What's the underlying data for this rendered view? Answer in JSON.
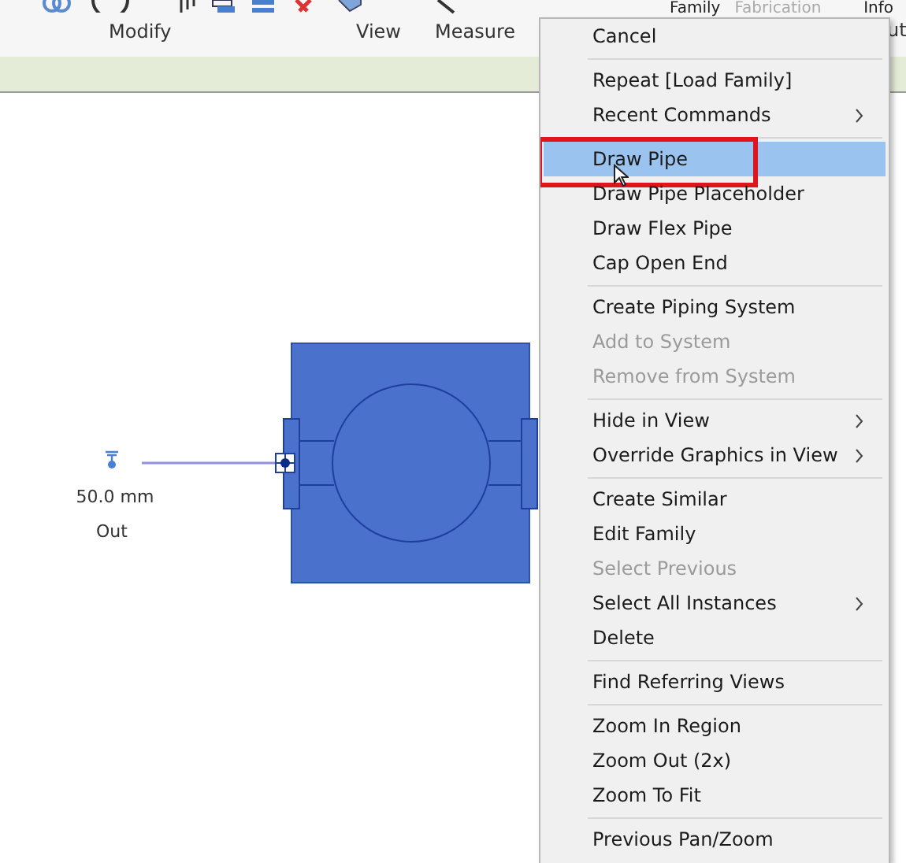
{
  "ribbon": {
    "tabs": [
      {
        "label": "Family",
        "disabled": false
      },
      {
        "label": "Fabrication",
        "disabled": true
      },
      {
        "label": "Info",
        "disabled": false
      }
    ],
    "panels": [
      "Modify",
      "View",
      "Measure"
    ],
    "cut_label": "ut"
  },
  "canvas": {
    "connector": {
      "size": "50.0 mm",
      "direction": "Out"
    }
  },
  "context_menu": {
    "items": [
      {
        "kind": "item",
        "label": "Cancel",
        "disabled": false,
        "submenu": false,
        "selected": false,
        "annotated": false
      },
      {
        "kind": "separator"
      },
      {
        "kind": "item",
        "label": "Repeat [Load Family]",
        "disabled": false,
        "submenu": false,
        "selected": false,
        "annotated": false
      },
      {
        "kind": "item",
        "label": "Recent Commands",
        "disabled": false,
        "submenu": true,
        "selected": false,
        "annotated": false
      },
      {
        "kind": "separator"
      },
      {
        "kind": "item",
        "label": "Draw Pipe",
        "disabled": false,
        "submenu": false,
        "selected": true,
        "annotated": true
      },
      {
        "kind": "item",
        "label": "Draw Pipe Placeholder",
        "disabled": false,
        "submenu": false,
        "selected": false,
        "annotated": false
      },
      {
        "kind": "item",
        "label": "Draw Flex Pipe",
        "disabled": false,
        "submenu": false,
        "selected": false,
        "annotated": false
      },
      {
        "kind": "item",
        "label": "Cap Open End",
        "disabled": false,
        "submenu": false,
        "selected": false,
        "annotated": false
      },
      {
        "kind": "separator"
      },
      {
        "kind": "item",
        "label": "Create Piping System",
        "disabled": false,
        "submenu": false,
        "selected": false,
        "annotated": false
      },
      {
        "kind": "item",
        "label": "Add to System",
        "disabled": true,
        "submenu": false,
        "selected": false,
        "annotated": false
      },
      {
        "kind": "item",
        "label": "Remove from System",
        "disabled": true,
        "submenu": false,
        "selected": false,
        "annotated": false
      },
      {
        "kind": "separator"
      },
      {
        "kind": "item",
        "label": "Hide in View",
        "disabled": false,
        "submenu": true,
        "selected": false,
        "annotated": false
      },
      {
        "kind": "item",
        "label": "Override Graphics in View",
        "disabled": false,
        "submenu": true,
        "selected": false,
        "annotated": false
      },
      {
        "kind": "separator"
      },
      {
        "kind": "item",
        "label": "Create Similar",
        "disabled": false,
        "submenu": false,
        "selected": false,
        "annotated": false
      },
      {
        "kind": "item",
        "label": "Edit Family",
        "disabled": false,
        "submenu": false,
        "selected": false,
        "annotated": false
      },
      {
        "kind": "item",
        "label": "Select Previous",
        "disabled": true,
        "submenu": false,
        "selected": false,
        "annotated": false
      },
      {
        "kind": "item",
        "label": "Select All Instances",
        "disabled": false,
        "submenu": true,
        "selected": false,
        "annotated": false
      },
      {
        "kind": "item",
        "label": "Delete",
        "disabled": false,
        "submenu": false,
        "selected": false,
        "annotated": false
      },
      {
        "kind": "separator"
      },
      {
        "kind": "item",
        "label": "Find Referring Views",
        "disabled": false,
        "submenu": false,
        "selected": false,
        "annotated": false
      },
      {
        "kind": "separator"
      },
      {
        "kind": "item",
        "label": "Zoom In Region",
        "disabled": false,
        "submenu": false,
        "selected": false,
        "annotated": false
      },
      {
        "kind": "item",
        "label": "Zoom Out (2x)",
        "disabled": false,
        "submenu": false,
        "selected": false,
        "annotated": false
      },
      {
        "kind": "item",
        "label": "Zoom To Fit",
        "disabled": false,
        "submenu": false,
        "selected": false,
        "annotated": false
      },
      {
        "kind": "separator"
      },
      {
        "kind": "item",
        "label": "Previous Pan/Zoom",
        "disabled": false,
        "submenu": false,
        "selected": false,
        "annotated": false
      }
    ]
  }
}
